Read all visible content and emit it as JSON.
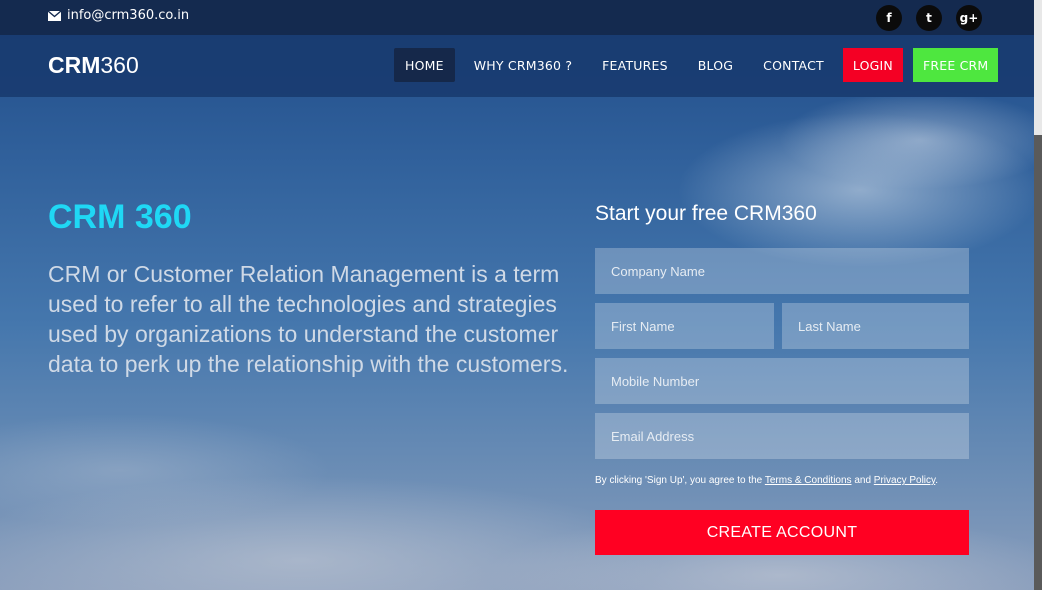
{
  "topbar": {
    "email": "info@crm360.co.in",
    "social": [
      {
        "icon": "facebook-icon",
        "glyph": "f"
      },
      {
        "icon": "twitter-icon",
        "glyph": "t"
      },
      {
        "icon": "google-plus-icon",
        "glyph": "g+"
      }
    ]
  },
  "navbar": {
    "logo_bold": "CRM",
    "logo_rest": "360",
    "items": [
      {
        "label": "HOME"
      },
      {
        "label": "WHY CRM360 ?"
      },
      {
        "label": "FEATURES"
      },
      {
        "label": "BLOG"
      },
      {
        "label": "CONTACT"
      },
      {
        "label": "LOGIN"
      },
      {
        "label": "FREE CRM"
      }
    ]
  },
  "hero": {
    "title": "CRM 360",
    "text": "CRM or Customer Relation Management is a term used to refer to all the technologies and strategies used by organizations to understand the customer data to perk up the relationship with the customers."
  },
  "form": {
    "title": "Start your free CRM360",
    "company_placeholder": "Company Name",
    "first_name_placeholder": "First Name",
    "last_name_placeholder": "Last Name",
    "mobile_placeholder": "Mobile Number",
    "email_placeholder": "Email Address",
    "terms_prefix": "By clicking 'Sign Up', you agree to the ",
    "terms_link": "Terms & Conditions",
    "terms_mid": " and ",
    "privacy_link": "Privacy Policy",
    "terms_suffix": ".",
    "submit_label": "CREATE ACCOUNT"
  },
  "colors": {
    "accent_cyan": "#1fd8f5",
    "login_red": "#f40024",
    "free_green": "#4ee73f",
    "cta_red": "#ff0022"
  }
}
